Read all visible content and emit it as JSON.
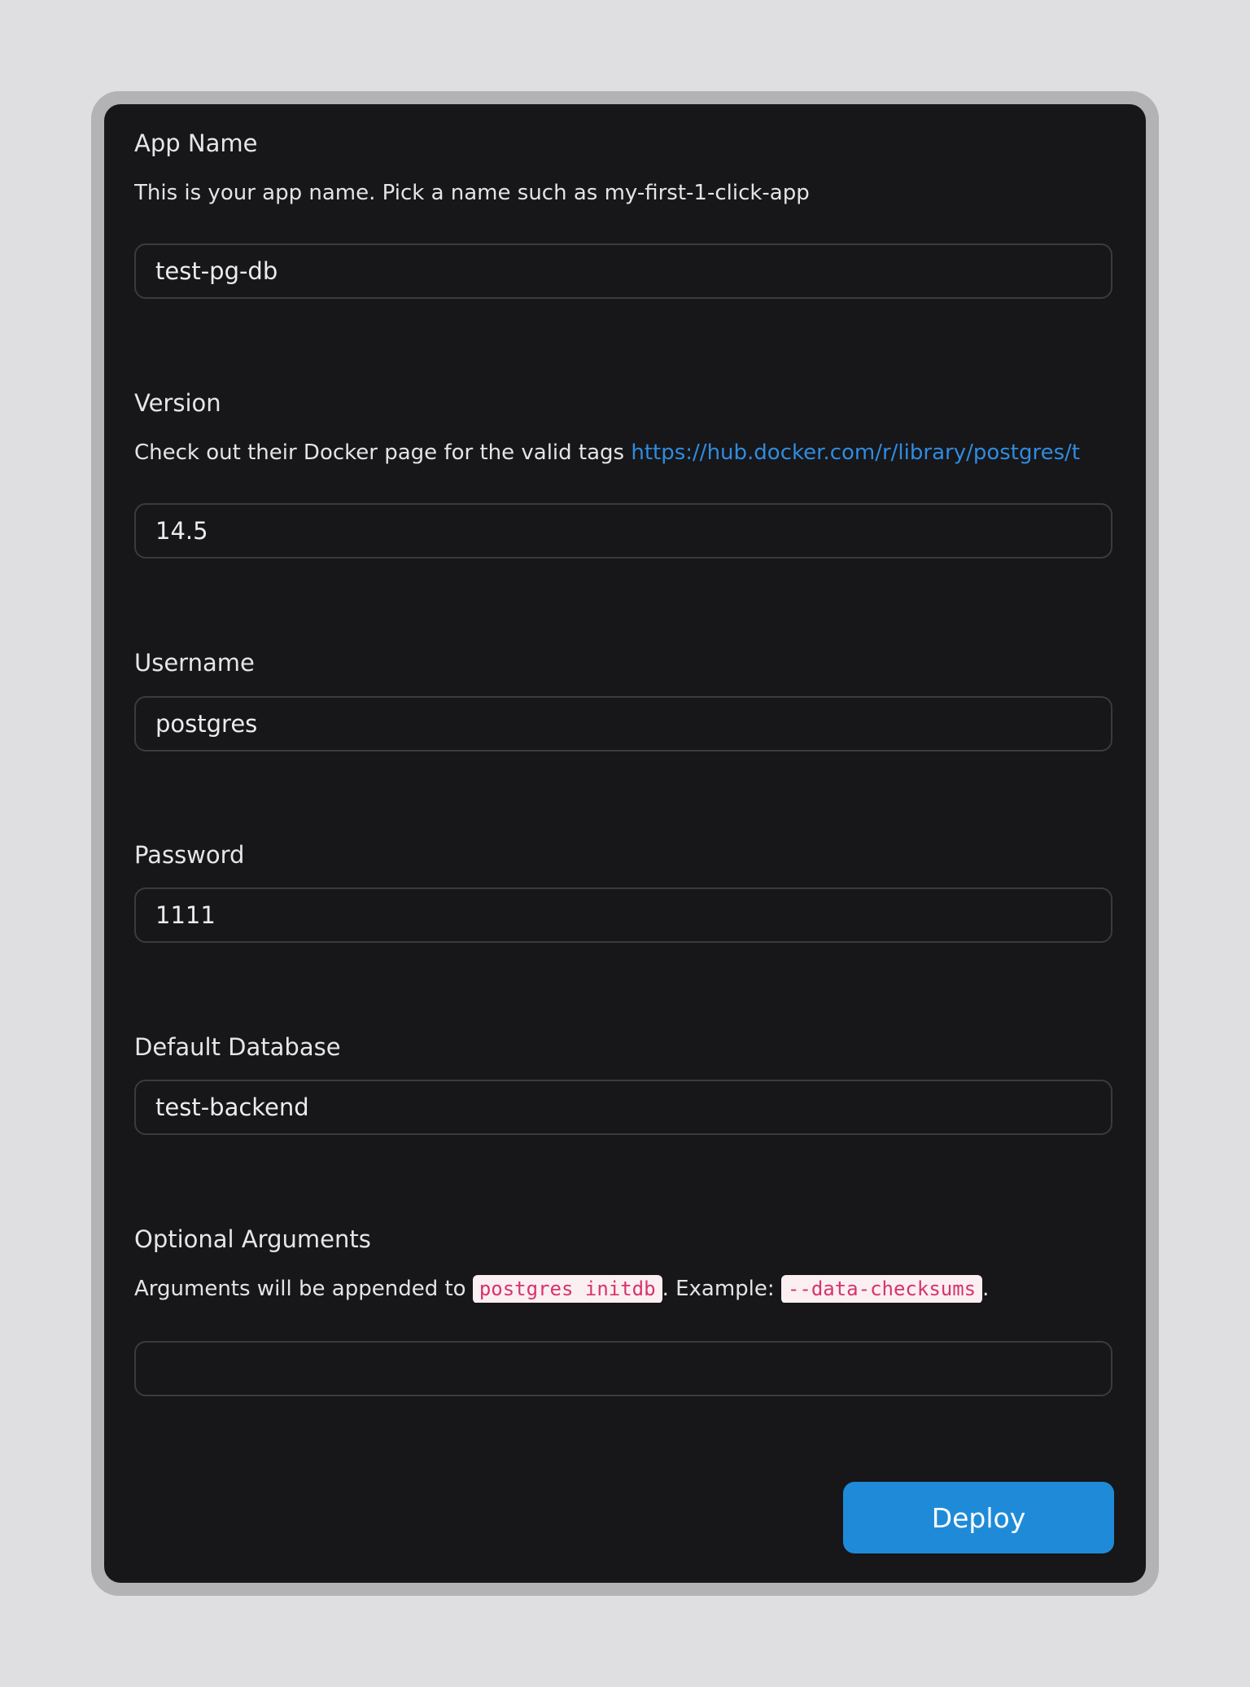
{
  "form": {
    "app_name": {
      "label": "App Name",
      "description": "This is your app name. Pick a name such as my-first-1-click-app",
      "value": "test-pg-db"
    },
    "version": {
      "label": "Version",
      "description": "Check out their Docker page for the valid tags",
      "link_text": "https://hub.docker.com/r/library/postgres/t",
      "value": "14.5"
    },
    "username": {
      "label": "Username",
      "value": "postgres"
    },
    "password": {
      "label": "Password",
      "value": "1111"
    },
    "default_database": {
      "label": "Default Database",
      "value": "test-backend"
    },
    "optional_arguments": {
      "label": "Optional Arguments",
      "desc_prefix": "Arguments will be appended to",
      "code_command": "postgres initdb",
      "desc_middle": ". Example:",
      "code_example": "--data-checksums",
      "desc_suffix": ".",
      "value": ""
    },
    "deploy_label": "Deploy"
  }
}
